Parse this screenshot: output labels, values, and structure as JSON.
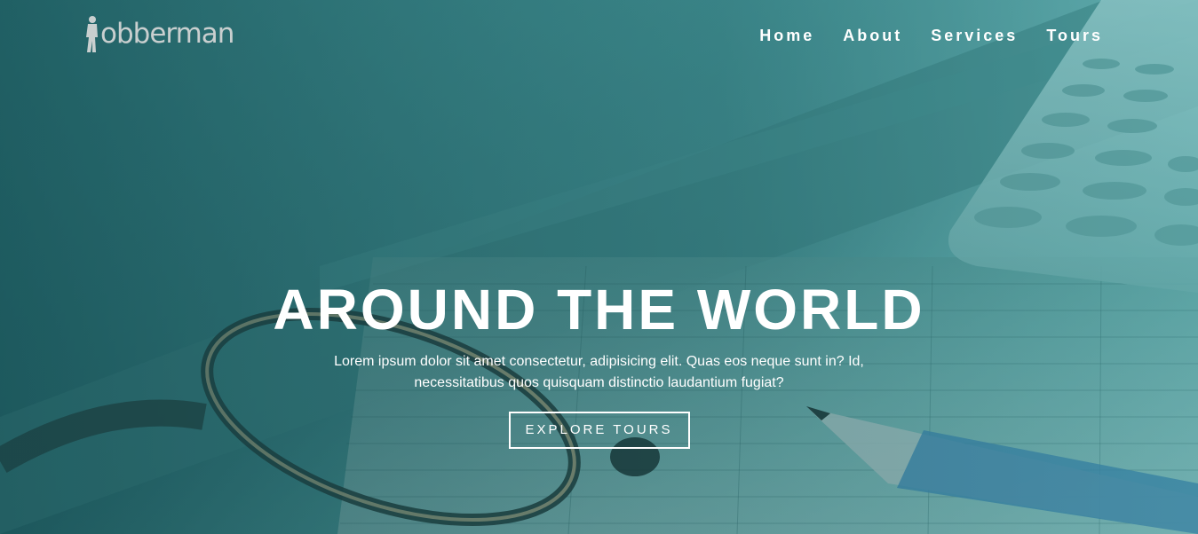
{
  "brand": {
    "logo_text": "obberman",
    "logo_icon": "person-silhouette-icon"
  },
  "nav": {
    "items": [
      {
        "label": "Home"
      },
      {
        "label": "About"
      },
      {
        "label": "Services"
      },
      {
        "label": "Tours"
      }
    ]
  },
  "hero": {
    "title": "AROUND THE WORLD",
    "subtitle": "Lorem ipsum dolor sit amet consectetur, adipisicing elit. Quas eos neque sunt in? Id, necessitatibus quos quisquam distinctio laudantium fugiat?",
    "cta_label": "EXPLORE TOURS"
  },
  "colors": {
    "overlay_teal": "#2e6e73",
    "accent_light": "#9fe3e3",
    "text": "#ffffff",
    "logo_gray": "#c9cfcf"
  }
}
